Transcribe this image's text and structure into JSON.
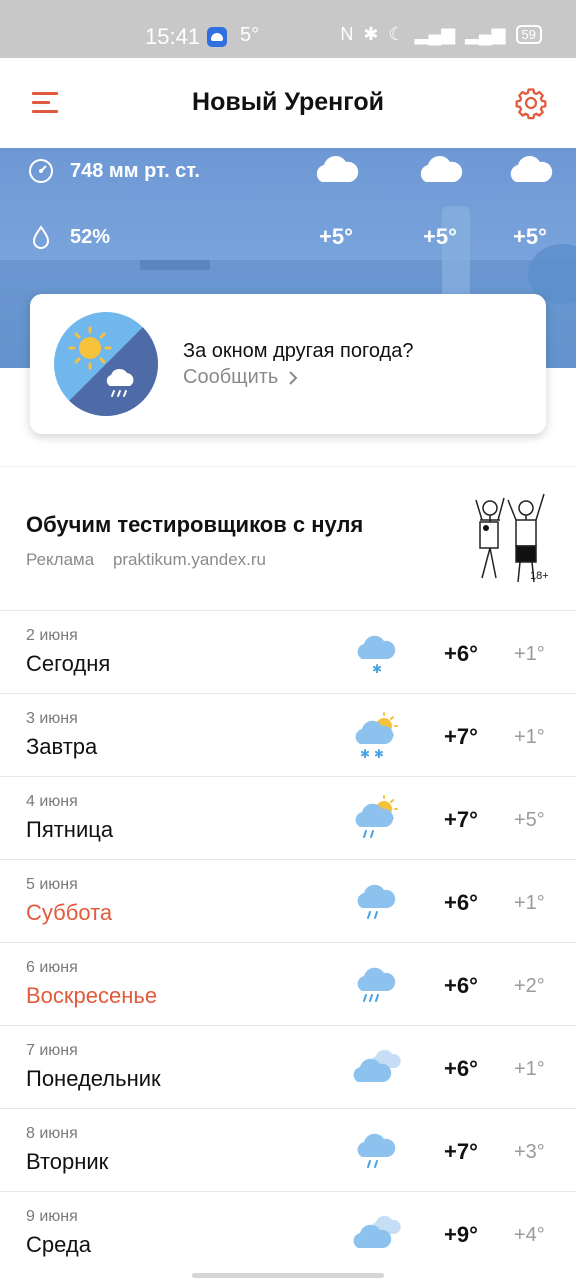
{
  "status_bar": {
    "time": "15:41",
    "temperature": "5°",
    "battery": "59"
  },
  "header": {
    "city": "Новый Уренгой",
    "menu_icon": "menu-icon",
    "settings_icon": "gear-icon",
    "accent_color": "#e25a3c"
  },
  "hero": {
    "pressure": "748 мм рт. ст.",
    "humidity": "52%",
    "hourly": [
      {
        "temp": "+5°",
        "icon": "cloudy-icon"
      },
      {
        "temp": "+5°",
        "icon": "cloudy-icon"
      },
      {
        "temp": "+5°",
        "icon": "cloudy-icon"
      }
    ]
  },
  "report": {
    "question": "За окном другая погода?",
    "link": "Сообщить"
  },
  "ad": {
    "title": "Обучим тестировщиков с нуля",
    "label": "Реклама",
    "domain": "praktikum.yandex.ru",
    "age": "18+"
  },
  "forecast": [
    {
      "date": "2 июня",
      "day": "Сегодня",
      "max": "+6°",
      "min": "+1°",
      "icon": "cloud-snow-icon",
      "weekend": false
    },
    {
      "date": "3 июня",
      "day": "Завтра",
      "max": "+7°",
      "min": "+1°",
      "icon": "sun-cloud-snow-icon",
      "weekend": false
    },
    {
      "date": "4 июня",
      "day": "Пятница",
      "max": "+7°",
      "min": "+5°",
      "icon": "sun-cloud-rain-icon",
      "weekend": false
    },
    {
      "date": "5 июня",
      "day": "Суббота",
      "max": "+6°",
      "min": "+1°",
      "icon": "cloud-rain-icon",
      "weekend": true
    },
    {
      "date": "6 июня",
      "day": "Воскресенье",
      "max": "+6°",
      "min": "+2°",
      "icon": "cloud-heavy-rain-icon",
      "weekend": true
    },
    {
      "date": "7 июня",
      "day": "Понедельник",
      "max": "+6°",
      "min": "+1°",
      "icon": "overcast-icon",
      "weekend": false
    },
    {
      "date": "8 июня",
      "day": "Вторник",
      "max": "+7°",
      "min": "+3°",
      "icon": "cloud-rain-icon",
      "weekend": false
    },
    {
      "date": "9 июня",
      "day": "Среда",
      "max": "+9°",
      "min": "+4°",
      "icon": "overcast-icon",
      "weekend": false
    }
  ]
}
